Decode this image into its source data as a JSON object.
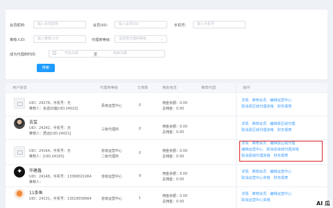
{
  "filters": {
    "member_nickname": {
      "label": "会员昵称:",
      "placeholder": "输入会员昵称"
    },
    "member_uid": {
      "label": "会员UID:",
      "placeholder": "输入会员UID"
    },
    "phone": {
      "label": "手机号:",
      "placeholder": "输入手机号"
    },
    "referrer_id": {
      "label": "推荐人ID:",
      "placeholder": "输入推荐人ID"
    },
    "agent_level": {
      "label": "代理商等级:",
      "placeholder": "请选择代理商等级"
    },
    "join_time": {
      "label": "成为代理商时间:",
      "start": "开始日期",
      "to": "至",
      "end": "结束日期"
    },
    "search_button": "搜索"
  },
  "table": {
    "columns": [
      "用户信息",
      "代理商等级",
      "订单数",
      "佣金信息",
      "推荐代理",
      "操作"
    ],
    "rows": [
      {
        "name": "",
        "uid": "UID：24278，手机号：无",
        "ref": "推荐人：余涵沅瑞[UID:24022]",
        "level": [
          "县级运营中心"
        ],
        "orders": "0",
        "commission": [
          "佣金余额：0.00",
          "总佣金：0.00"
        ],
        "recommend": "",
        "ops": [
          "详情",
          "推荐会员",
          "编辑运营中心",
          "取消县区域代理资格",
          "财务报表"
        ],
        "avatar": "placeholder"
      },
      {
        "name": "吉玺",
        "uid": "UID：24242，手机号：无",
        "ref": "推荐人：君远[UID:24021]",
        "level": [
          "三级代理商"
        ],
        "orders": "0",
        "commission": [
          "佣金余额：0.00",
          "总佣金：0.00"
        ],
        "recommend": "",
        "ops": [
          "详情",
          "推荐会员",
          "编辑县区域代理",
          "取消县区域代理资格",
          "财务报表"
        ],
        "avatar": "photo"
      },
      {
        "name": "",
        "uid": "UID：24164，手机号：无",
        "ref": "推荐人：[UID:24165]",
        "level": [
          "省级运营中心",
          "二级代理商"
        ],
        "orders": "0",
        "commission": [
          "佣金余额：0.00",
          "总佣金：0.00"
        ],
        "recommend": "",
        "ops": [
          "详情",
          "推荐会员",
          "编辑县区域代理",
          "编辑运营中心",
          "取消省级域代理资格",
          "取消县域代理资格",
          "财务报表"
        ],
        "avatar": "placeholder"
      },
      {
        "name": "华建鑫",
        "uid": "UID：24148，手机号：13368021064",
        "ref": "推荐人：",
        "level": [
          "省级运营中心"
        ],
        "orders": "9",
        "commission": [
          "佣金余额：0.00",
          "总佣金：0.00"
        ],
        "recommend": "",
        "ops": [
          "详情",
          "推荐会员",
          "编辑运营中心",
          "取消运营中心资格",
          "财务报表"
        ],
        "avatar": "dark"
      },
      {
        "name": "11条鱼",
        "uid": "UID：24131，手机号：13529558664",
        "ref": "",
        "level": [
          "省级运营中心"
        ],
        "orders": "1",
        "commission": [
          "佣金余额：0.00",
          "总佣金：0.00"
        ],
        "recommend": "",
        "ops": [
          "详情",
          "推荐会员",
          "编辑运营中心",
          "取消运营中心资格"
        ],
        "avatar": "fish"
      }
    ]
  },
  "watermark": "AI 瓜"
}
